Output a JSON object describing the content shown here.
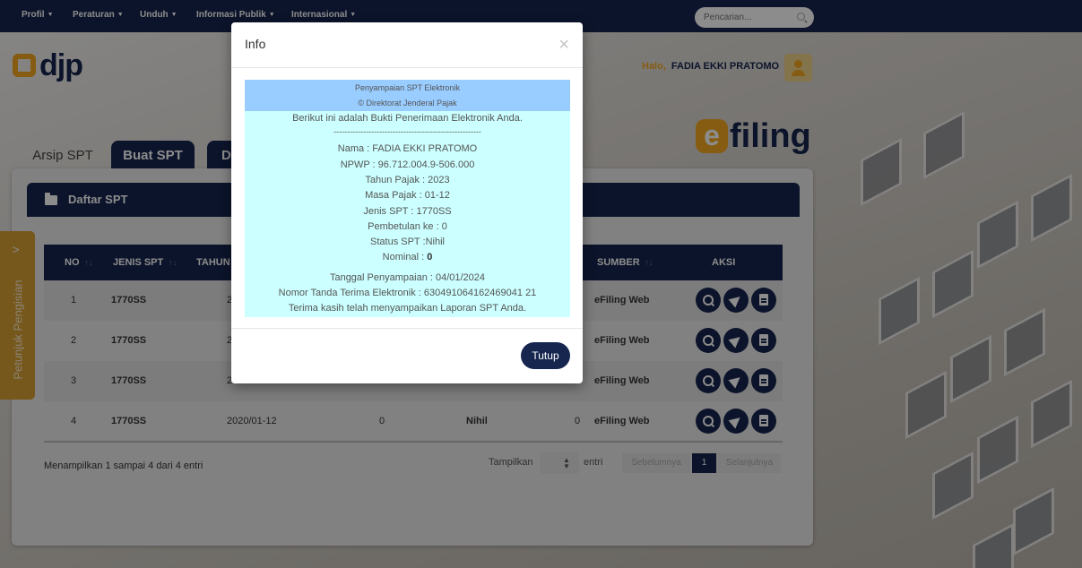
{
  "topbar": {
    "menus": [
      {
        "label": "Profil"
      },
      {
        "label": "Peraturan"
      },
      {
        "label": "Unduh"
      },
      {
        "label": "Informasi Publik"
      },
      {
        "label": "Internasional"
      }
    ],
    "search_placeholder": "Pencarian..."
  },
  "header": {
    "logo_text": "djp",
    "greeting": "Halo,",
    "user_name": "FADIA EKKI PRATOMO",
    "efiling_e": "e",
    "efiling_text": "filing"
  },
  "tabs": {
    "arsip": "Arsip SPT",
    "buat": "Buat SPT",
    "draft": "D"
  },
  "panel": {
    "title": "Daftar SPT"
  },
  "table": {
    "headers": {
      "no": "NO",
      "jenis": "JENIS SPT",
      "tahun": "TAHUN",
      "sumber": "SUMBER",
      "aksi": "AKSI"
    },
    "rows": [
      {
        "no": "1",
        "jenis": "1770SS",
        "tahun": "2",
        "pembetulan": "",
        "status": "",
        "nominal": "",
        "sumber": "eFiling Web"
      },
      {
        "no": "2",
        "jenis": "1770SS",
        "tahun": "2",
        "pembetulan": "",
        "status": "",
        "nominal": "",
        "sumber": "eFiling Web"
      },
      {
        "no": "3",
        "jenis": "1770SS",
        "tahun": "2",
        "pembetulan": "",
        "status": "",
        "nominal": "",
        "sumber": "eFiling Web"
      },
      {
        "no": "4",
        "jenis": "1770SS",
        "tahun": "2020/01-12",
        "pembetulan": "0",
        "status": "Nihil",
        "nominal": "0",
        "sumber": "eFiling Web"
      }
    ],
    "info": "Menampilkan 1 sampai 4 dari 4 entri",
    "tampilkan": "Tampilkan",
    "entri": "entri",
    "prev": "Sebelumnya",
    "page": "1",
    "next": "Selanjutnya"
  },
  "side_tab": {
    "label": "Petunjuk Pengisian",
    "arrow": ">"
  },
  "modal": {
    "title": "Info",
    "close": "×",
    "receipt": {
      "line1": "Penyampaian SPT Elektronik",
      "line2": "© Direktorat Jenderal Pajak",
      "intro": "Berikut ini adalah Bukti Penerimaan Elektronik Anda.",
      "separator": "-------------------------------------------------------",
      "nama": "Nama : FADIA EKKI PRATOMO",
      "npwp": "NPWP : 96.712.004.9-506.000",
      "tahun": "Tahun Pajak : 2023",
      "masa": "Masa Pajak : 01-12",
      "jenis": "Jenis SPT : 1770SS",
      "pembetulan": "Pembetulan ke : 0",
      "status": "Status SPT :Nihil",
      "nominal_label": "Nominal : ",
      "nominal_value": "0",
      "tanggal": "Tanggal Penyampaian : 04/01/2024",
      "ntte": "Nomor Tanda Terima Elektronik : 630491064162469041 21",
      "thanks": "Terima kasih telah menyampaikan Laporan SPT Anda."
    },
    "button": "Tutup"
  },
  "colors": {
    "navy": "#16264f",
    "orange": "#f3a81f",
    "receipt_band": "#99ccff",
    "receipt_body": "#ccffff"
  }
}
